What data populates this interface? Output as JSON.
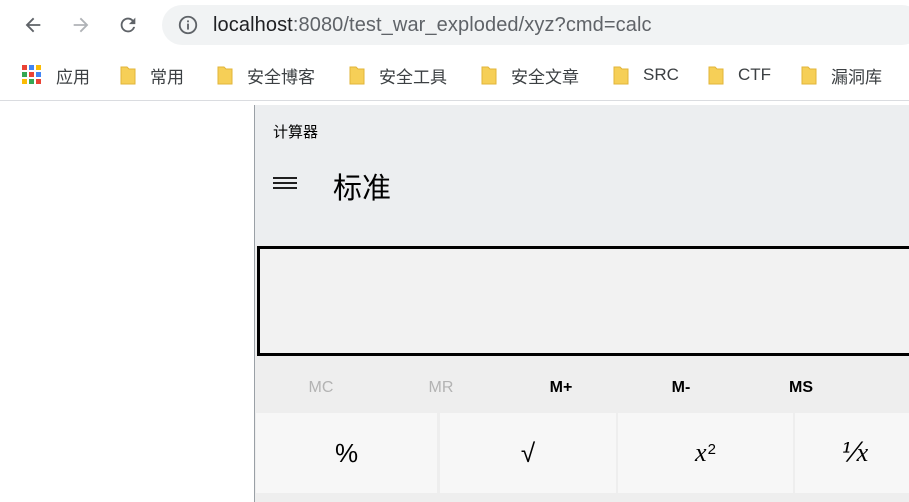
{
  "toolbar": {
    "url_host": "localhost",
    "url_rest": ":8080/test_war_exploded/xyz?cmd=calc"
  },
  "bookmarks": {
    "apps_label": "应用",
    "items": [
      {
        "label": "常用"
      },
      {
        "label": "安全博客"
      },
      {
        "label": "安全工具"
      },
      {
        "label": "安全文章"
      },
      {
        "label": "SRC"
      },
      {
        "label": "CTF"
      },
      {
        "label": "漏洞库"
      }
    ]
  },
  "calculator": {
    "window_title": "计算器",
    "mode": "标准",
    "display_value": "",
    "memory": [
      {
        "label": "MC",
        "enabled": false
      },
      {
        "label": "MR",
        "enabled": false
      },
      {
        "label": "M+",
        "enabled": true
      },
      {
        "label": "M-",
        "enabled": true
      },
      {
        "label": "MS",
        "enabled": true
      }
    ],
    "keys": {
      "percent": "%",
      "sqrt": "√",
      "square_base": "x",
      "square_exp": "2",
      "reciprocal": "⅟x"
    }
  },
  "colors": {
    "omnibox_bg": "#f1f3f4",
    "folder": "#f6cf57",
    "calc_bg": "#eeeeee",
    "key_bg": "#f7f7f7"
  }
}
